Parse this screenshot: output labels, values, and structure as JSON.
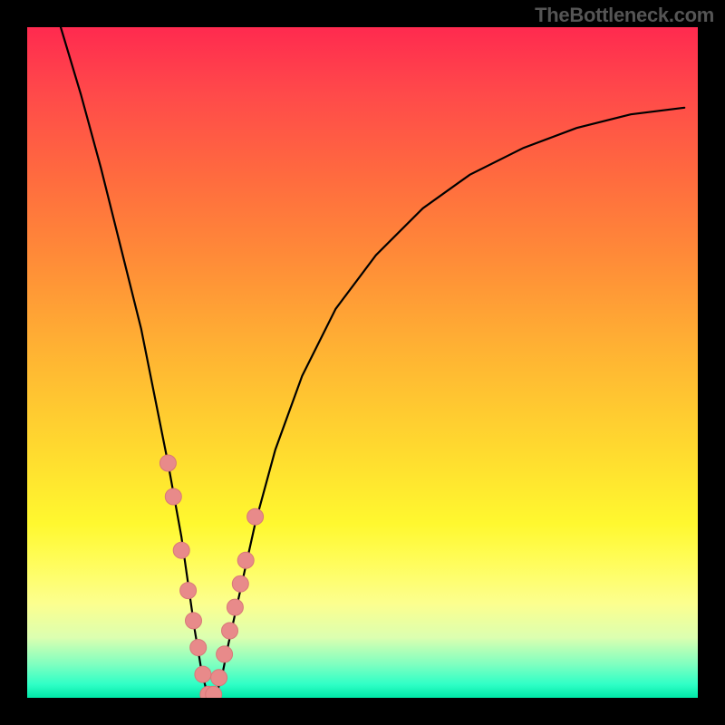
{
  "watermark": "TheBottleneck.com",
  "colors": {
    "curve_stroke": "#000000",
    "marker_fill": "#e88a8a",
    "marker_stroke": "#d87878",
    "frame_bg": "#000000"
  },
  "chart_data": {
    "type": "line",
    "title": "",
    "xlabel": "",
    "ylabel": "",
    "xlim": [
      0,
      100
    ],
    "ylim": [
      0,
      100
    ],
    "notes": "Bottleneck-vs-component curve; y ≈ bottleneck %. Minimum near x≈27 (y≈0). Background gradient encodes y (red≈100 → green≈0). No axis ticks or numeric labels are rendered.",
    "series": [
      {
        "name": "bottleneck-curve",
        "x": [
          5,
          8,
          11,
          14,
          17,
          19,
          21,
          23,
          24,
          25,
          26,
          27,
          28,
          29,
          30,
          32,
          34,
          37,
          41,
          46,
          52,
          59,
          66,
          74,
          82,
          90,
          98
        ],
        "values": [
          100,
          90,
          79,
          67,
          55,
          45,
          35,
          24,
          17,
          10,
          4,
          0,
          0,
          3,
          8,
          17,
          26,
          37,
          48,
          58,
          66,
          73,
          78,
          82,
          85,
          87,
          88
        ]
      }
    ],
    "markers": {
      "name": "highlighted-points",
      "x": [
        21.0,
        21.8,
        23.0,
        24.0,
        24.8,
        25.5,
        26.2,
        27.0,
        27.8,
        28.6,
        29.4,
        30.2,
        31.0,
        31.8,
        32.6,
        34.0
      ],
      "values": [
        35.0,
        30.0,
        22.0,
        16.0,
        11.5,
        7.5,
        3.5,
        0.5,
        0.5,
        3.0,
        6.5,
        10.0,
        13.5,
        17.0,
        20.5,
        27.0
      ],
      "radius_px": 9
    }
  }
}
